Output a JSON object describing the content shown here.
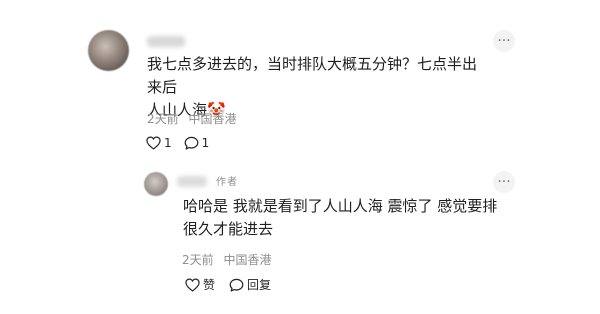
{
  "comment": {
    "text": "我七点多进去的，当时排队大概五分钟？七点半出来后\n人山人海🤡",
    "time": "2天前",
    "location": "中国香港",
    "like_count": "1",
    "reply_count": "1",
    "more_label": "···"
  },
  "reply": {
    "author_tag": "作者",
    "text": "哈哈是 我就是看到了人山人海 震惊了 感觉要排\n很久才能进去",
    "time": "2天前",
    "location": "中国香港",
    "like_label": "赞",
    "reply_label": "回复",
    "more_label": "···"
  },
  "icons": {
    "like": "heart-icon",
    "comment": "comment-bubble-icon",
    "more": "more-horizontal-icon"
  }
}
